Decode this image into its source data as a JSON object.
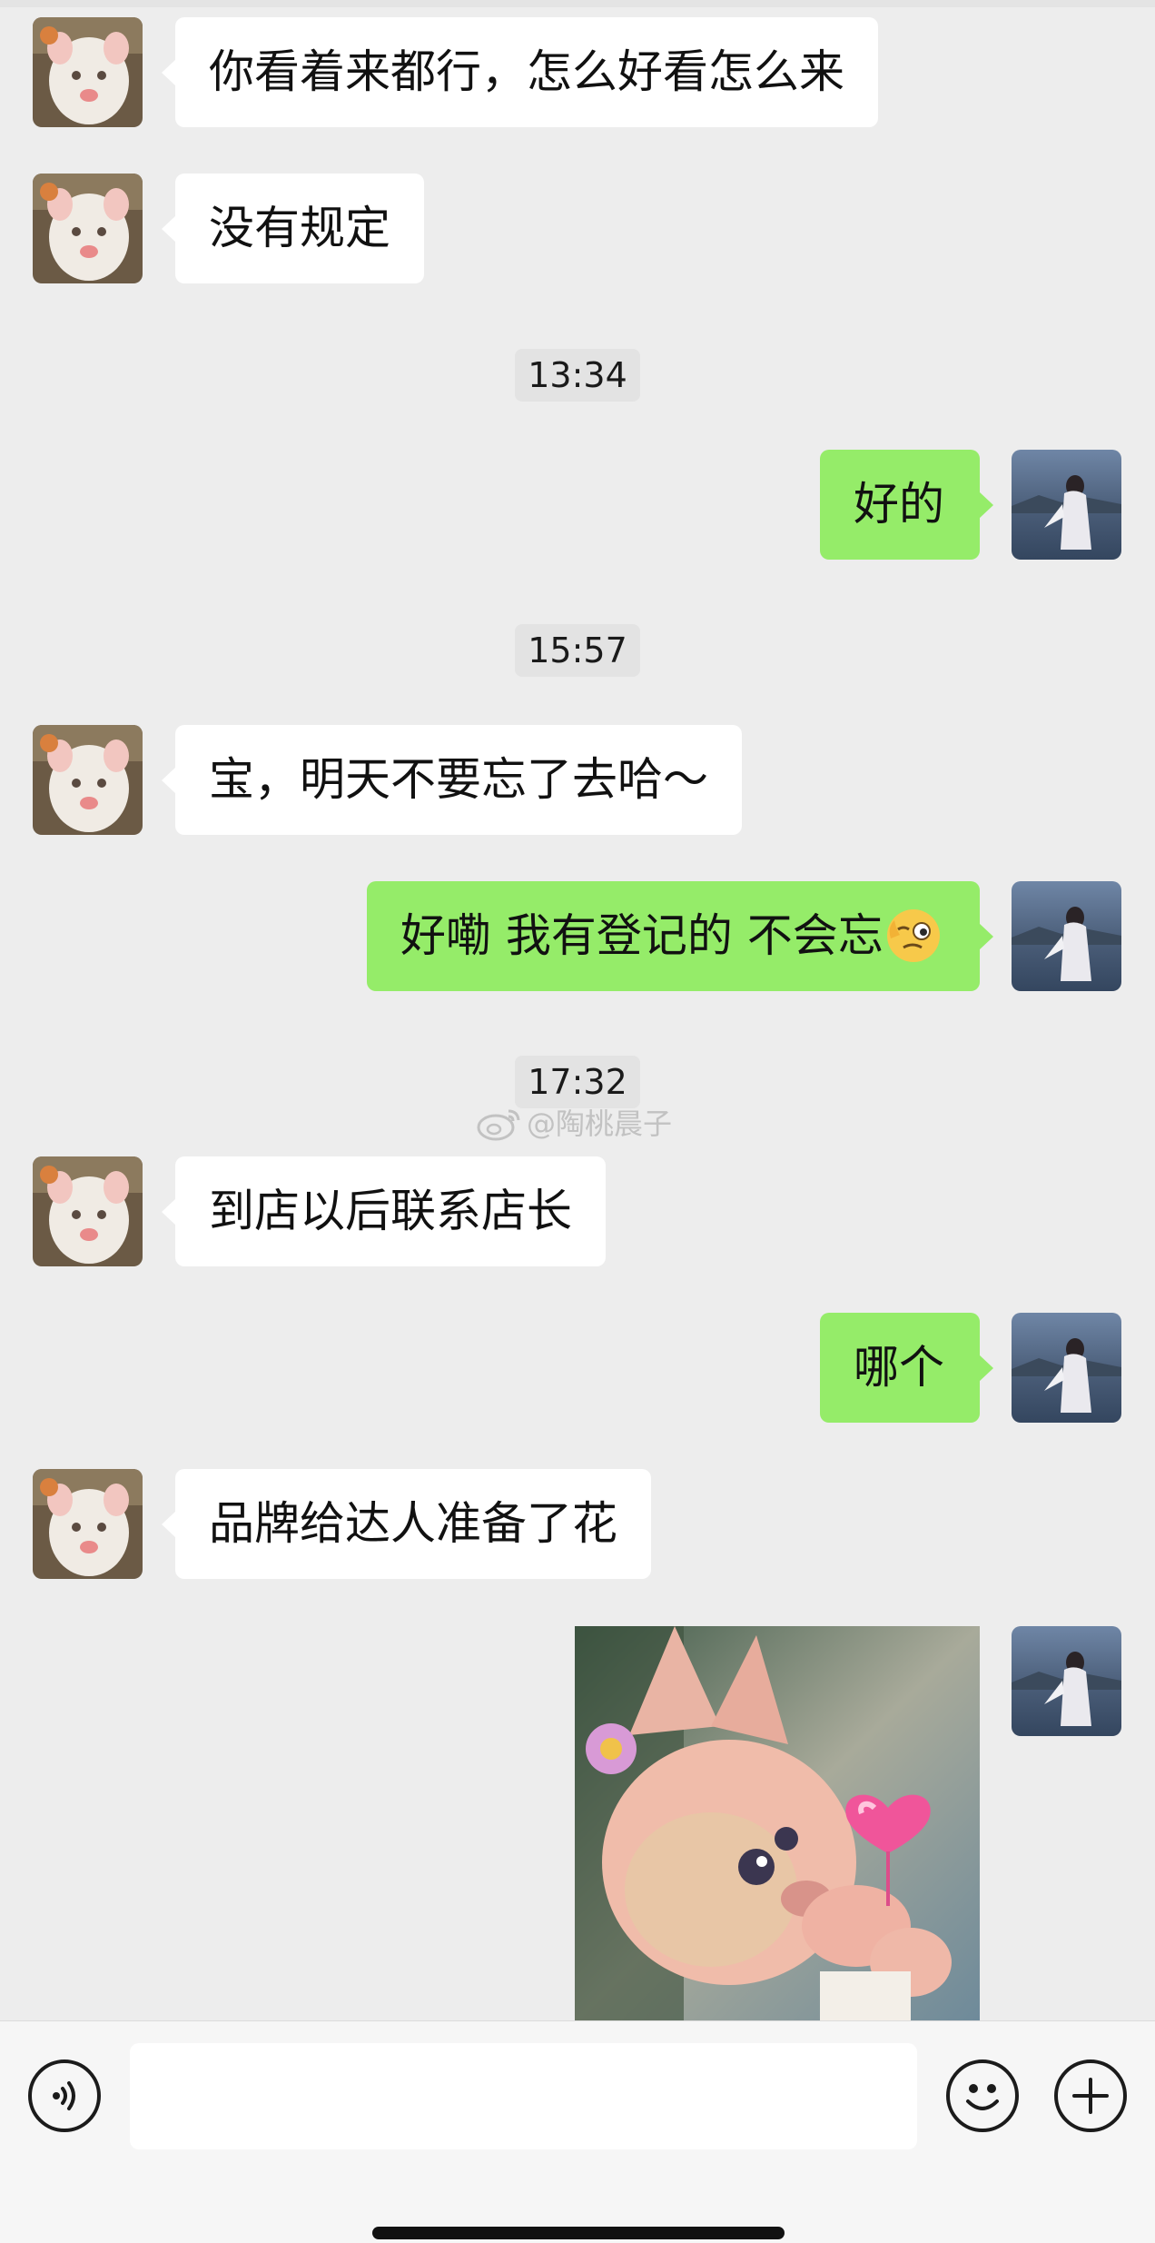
{
  "messages": [
    {
      "side": "in",
      "text": "你看着来都行，怎么好看怎么来"
    },
    {
      "side": "in",
      "text": "没有规定"
    },
    {
      "type": "time",
      "text": "13:34"
    },
    {
      "side": "out",
      "text": "好的"
    },
    {
      "type": "time",
      "text": "15:57"
    },
    {
      "side": "in",
      "text": "宝，明天不要忘了去哈～"
    },
    {
      "side": "out",
      "text": "好嘞 我有登记的 不会忘",
      "emoji": "winking-face-emoji"
    },
    {
      "type": "time",
      "text": "17:32"
    },
    {
      "side": "in",
      "text": "到店以后联系店长"
    },
    {
      "side": "out",
      "text": "哪个"
    },
    {
      "side": "in",
      "text": "品牌给达人准备了花"
    },
    {
      "side": "out",
      "type": "sticker",
      "sticker": "pink-fox-plush-heart-sticker"
    }
  ],
  "watermark": {
    "icon": "weibo-icon",
    "text": "@陶桃晨子"
  },
  "input_bar": {
    "voice_icon": "voice-icon",
    "emoji_icon": "emoji-icon",
    "plus_icon": "plus-icon",
    "input_value": ""
  },
  "colors": {
    "background": "#ededed",
    "incoming_bubble": "#ffffff",
    "outgoing_bubble": "#95ec69",
    "time_badge": "#e3e3e3"
  }
}
